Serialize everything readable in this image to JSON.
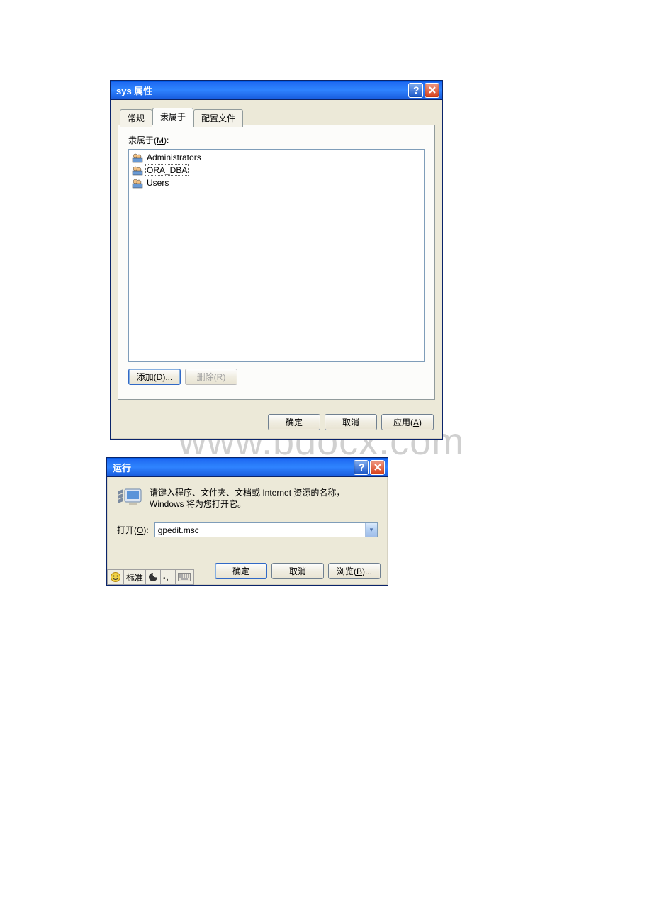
{
  "watermark": "www.bdocx.com",
  "props_dialog": {
    "title": "sys 属性",
    "tabs": [
      "常规",
      "隶属于",
      "配置文件"
    ],
    "active_tab_index": 1,
    "group_label": "隶属于(M):",
    "items": [
      "Administrators",
      "ORA_DBA",
      "Users"
    ],
    "add_btn": "添加(D)...",
    "remove_btn": "删除(R)",
    "ok_btn": "确定",
    "cancel_btn": "取消",
    "apply_btn": "应用(A)"
  },
  "run_dialog": {
    "title": "运行",
    "description": "请键入程序、文件夹、文档或 Internet 资源的名称，Windows 将为您打开它。",
    "open_label": "打开(O):",
    "open_value": "gpedit.msc",
    "ok_btn": "确定",
    "cancel_btn": "取消",
    "browse_btn": "浏览(B)..."
  },
  "ime": {
    "label": "标准"
  }
}
